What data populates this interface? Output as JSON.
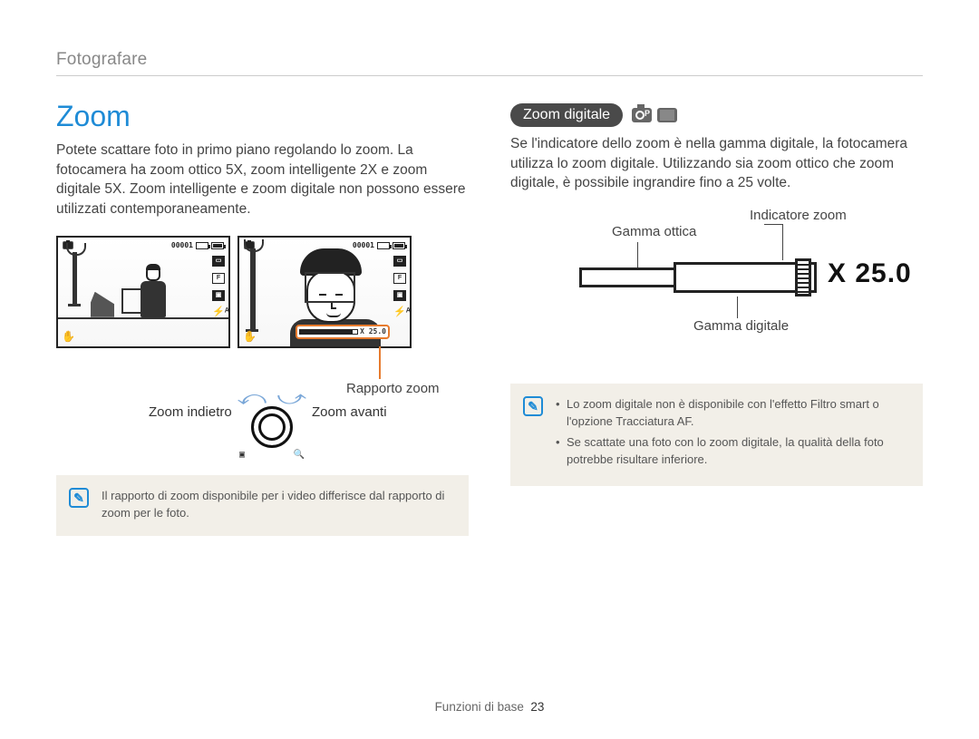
{
  "breadcrumb": "Fotografare",
  "left": {
    "heading": "Zoom",
    "body": "Potete scattare foto in primo piano regolando lo zoom. La fotocamera ha zoom ottico 5X, zoom intelligente 2X e zoom digitale 5X. Zoom intelligente e zoom digitale non possono essere utilizzati contemporaneamente.",
    "lcd_counter": "00001",
    "zoom_ratio_inbar": "X 25.0",
    "cl_ratio": "Rapporto zoom",
    "cl_back": "Zoom indietro",
    "cl_fwd": "Zoom avanti",
    "note": "Il rapporto di zoom disponibile per i video differisce dal rapporto di zoom per le foto."
  },
  "right": {
    "pill": "Zoom digitale",
    "body": "Se l'indicatore dello zoom è nella gamma digitale, la fotocamera utilizza lo zoom digitale. Utilizzando sia zoom ottico che zoom digitale, è possibile ingrandire fino a 25 volte.",
    "lbl_indicator": "Indicatore zoom",
    "lbl_optical": "Gamma ottica",
    "lbl_digital": "Gamma digitale",
    "zoom_value": "X 25.0",
    "note_items": [
      "Lo zoom digitale non è disponibile con l'effetto Filtro smart o l'opzione Tracciatura AF.",
      "Se scattate una foto con lo zoom digitale, la qualità della foto potrebbe risultare inferiore."
    ]
  },
  "footer": {
    "section": "Funzioni di base",
    "page": "23"
  }
}
